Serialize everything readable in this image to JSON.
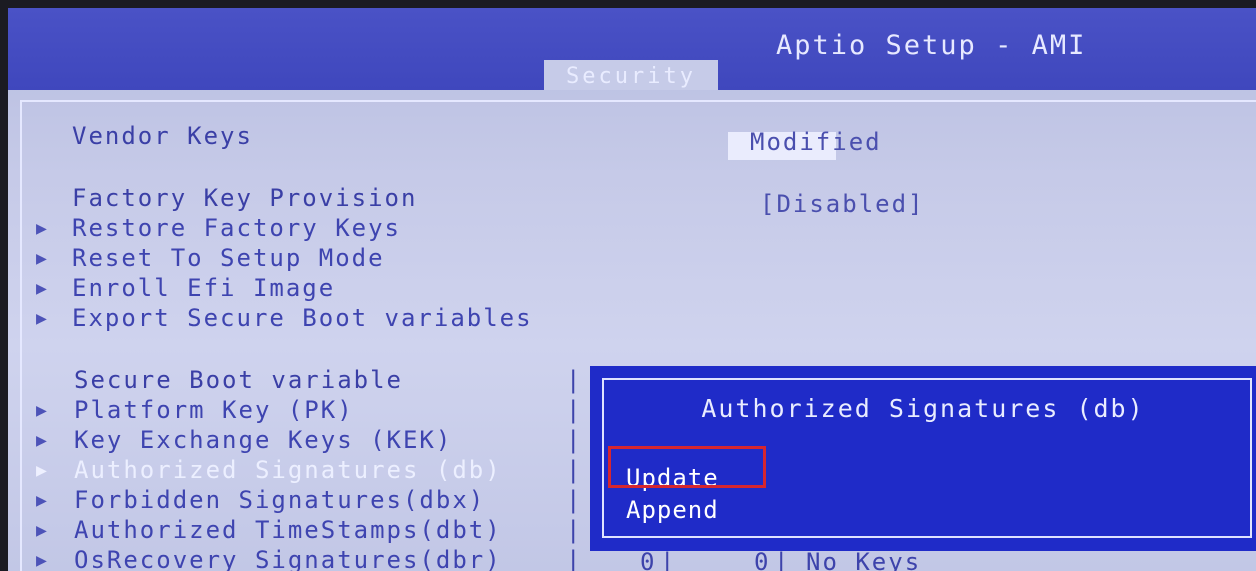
{
  "header": {
    "title": "Aptio Setup - AMI",
    "active_tab": "Security"
  },
  "settings": {
    "vendor_keys_label": "Vendor Keys",
    "vendor_keys_value": "Modified",
    "factory_key_label": "Factory Key Provision",
    "factory_key_value": "[Disabled]",
    "restore_factory_keys": "Restore Factory Keys",
    "reset_setup_mode": "Reset To Setup Mode",
    "enroll_efi_image": "Enroll Efi Image",
    "export_variables": "Export Secure Boot variables",
    "secure_boot_variable": "Secure Boot variable",
    "platform_key": "Platform Key        (PK)",
    "key_exchange": "Key Exchange Keys    (KEK)",
    "authorized_signatures": "Authorized Signatures (db)",
    "forbidden_signatures": "Forbidden  Signatures(dbx)",
    "authorized_timestamps": "Authorized TimeStamps(dbt)",
    "osrecovery_signatures": "OsRecovery Signatures(dbr)"
  },
  "bottom": {
    "count1": "0",
    "count2": "0",
    "status": "No Keys"
  },
  "dialog": {
    "title": "Authorized Signatures (db)",
    "options": [
      "Update",
      "Append"
    ],
    "selected": "Update"
  },
  "colors": {
    "header": "#4a52c6",
    "dialog": "#1f2bc8",
    "highlight": "#d6262f"
  }
}
